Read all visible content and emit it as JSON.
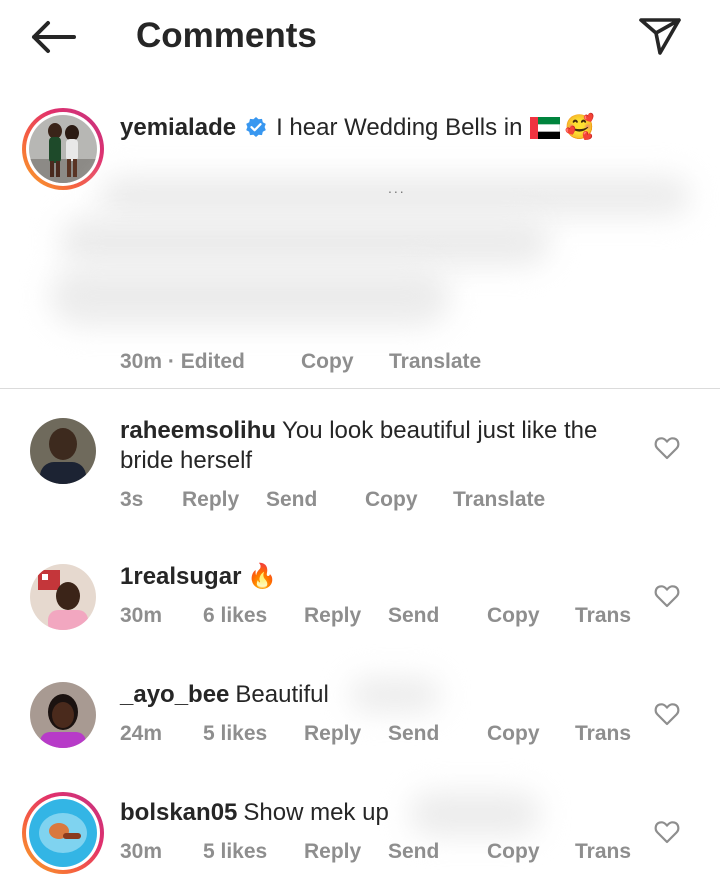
{
  "header": {
    "title": "Comments",
    "back_icon": "arrow-left-icon",
    "share_icon": "paper-plane-icon"
  },
  "caption": {
    "username": "yemialade",
    "text": "I hear Wedding Bells in",
    "flag_icon": "uae-flag-icon",
    "emoji": "🥰",
    "ellipsis": "...",
    "time": "30m · Edited",
    "copy_label": "Copy",
    "translate_label": "Translate"
  },
  "comments": [
    {
      "username": "raheemsolihu",
      "text": "You look beautiful just like the bride herself",
      "time": "3s",
      "reply": "Reply",
      "send": "Send",
      "copy": "Copy",
      "translate": "Translate"
    },
    {
      "username": "1realsugar",
      "text": "🔥",
      "time": "30m",
      "likes": "6 likes",
      "reply": "Reply",
      "send": "Send",
      "copy": "Copy",
      "translate": "Trans"
    },
    {
      "username": "_ayo_bee",
      "text": "Beautiful",
      "time": "24m",
      "likes": "5 likes",
      "reply": "Reply",
      "send": "Send",
      "copy": "Copy",
      "translate": "Trans"
    },
    {
      "username": "bolskan05",
      "text": "Show mek up",
      "time": "30m",
      "likes": "5 likes",
      "reply": "Reply",
      "send": "Send",
      "copy": "Copy",
      "translate": "Trans"
    }
  ],
  "colors": {
    "text": "#262626",
    "secondary": "#8e8e8e",
    "verified": "#3897f0",
    "divider": "#dbdbdb"
  }
}
